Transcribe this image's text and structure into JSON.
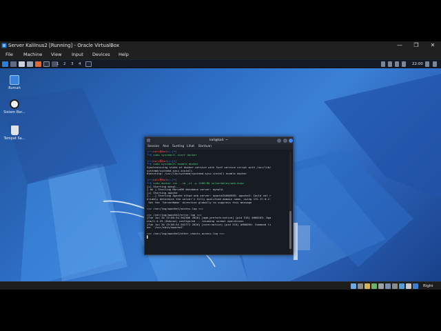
{
  "window": {
    "title": "Server KaliInus2 [Running] - Oracle VirtualBox",
    "controls": {
      "minimize": "—",
      "restore": "❐",
      "close": "✕"
    }
  },
  "menubar": {
    "items": [
      "File",
      "Machine",
      "View",
      "Input",
      "Devices",
      "Help"
    ]
  },
  "guest_panel": {
    "workspaces": [
      "1",
      "2",
      "3",
      "4"
    ],
    "clock": "22:00"
  },
  "desktop_icons": [
    {
      "label": "Rumah",
      "icon": "home-folder-icon"
    },
    {
      "label": "Sistem Ber...",
      "icon": "filesystem-icon"
    },
    {
      "label": "Tempat Sa...",
      "icon": "trash-icon"
    }
  ],
  "terminal": {
    "title": "kali@kali: ~",
    "menu": [
      "Session",
      "Aksi",
      "Sunting",
      "Lihat",
      "Bantuan"
    ],
    "lines": [
      [
        {
          "t": "┌──(",
          "c": "c-blue"
        },
        {
          "t": "kali㉿kali",
          "c": "c-red"
        },
        {
          "t": ")-[",
          "c": "c-blue"
        },
        {
          "t": "~",
          "c": "c-white"
        },
        {
          "t": "]",
          "c": "c-blue"
        }
      ],
      [
        {
          "t": "└─$ ",
          "c": "c-blue"
        },
        {
          "t": "sudo systemctl start docker",
          "c": "c-green"
        }
      ],
      [
        {
          "t": "",
          "c": ""
        }
      ],
      [
        {
          "t": "┌──(",
          "c": "c-blue"
        },
        {
          "t": "kali㉿kali",
          "c": "c-red"
        },
        {
          "t": ")-[",
          "c": "c-blue"
        },
        {
          "t": "~",
          "c": "c-white"
        },
        {
          "t": "]",
          "c": "c-blue"
        }
      ],
      [
        {
          "t": "└─$ ",
          "c": "c-blue"
        },
        {
          "t": "sudo systemctl enable docker",
          "c": "c-green"
        }
      ],
      [
        {
          "t": "Synchronizing state of docker.service with SysV service script with /usr/lib/",
          "c": ""
        }
      ],
      [
        {
          "t": "systemd/systemd-sysv-install.",
          "c": ""
        }
      ],
      [
        {
          "t": "Executing: /usr/lib/systemd/systemd-sysv-install enable docker",
          "c": ""
        }
      ],
      [
        {
          "t": "",
          "c": ""
        }
      ],
      [
        {
          "t": "┌──(",
          "c": "c-blue"
        },
        {
          "t": "kali㉿kali",
          "c": "c-red"
        },
        {
          "t": ")-[",
          "c": "c-blue"
        },
        {
          "t": "~",
          "c": "c-white"
        },
        {
          "t": "]",
          "c": "c-blue"
        }
      ],
      [
        {
          "t": "└─$ ",
          "c": "c-blue"
        },
        {
          "t": "sudo docker run --rm -it -p 1280:80 vulnerables/web-dvwa",
          "c": "c-green"
        }
      ],
      [
        {
          "t": "[+] Starting mysql...",
          "c": ""
        }
      ],
      [
        {
          "t": "[ ok ] Starting MariaDB database server: mysqld.",
          "c": ""
        }
      ],
      [
        {
          "t": "[+] Starting apache",
          "c": ""
        }
      ],
      [
        {
          "t": "[....] Starting Apache httpd web server: apache2AH00558: apache2: Could not r",
          "c": ""
        }
      ],
      [
        {
          "t": "eliably determine the server's fully qualified domain name, using 172.17.0.2.",
          "c": ""
        }
      ],
      [
        {
          "t": " Set the 'ServerName' directive globally to suppress this message",
          "c": ""
        }
      ],
      [
        {
          "t": ".",
          "c": ""
        }
      ],
      [
        {
          "t": "==> /var/log/apache2/access.log <==",
          "c": ""
        }
      ],
      [
        {
          "t": "",
          "c": ""
        }
      ],
      [
        {
          "t": "==> /var/log/apache2/error.log <==",
          "c": ""
        }
      ],
      [
        {
          "t": "[Tue Jun 20 15:00:34.942306 2026] [mpm_prefork:notice] [pid 316] AH00163: Apa",
          "c": ""
        }
      ],
      [
        {
          "t": "che/2.4.25 (Debian) configured -- resuming normal operations",
          "c": ""
        }
      ],
      [
        {
          "t": "[Tue Jun 20 15:00:34.942771 2026] [core:notice] [pid 316] AH00094: Command li",
          "c": ""
        }
      ],
      [
        {
          "t": "ne: '/usr/sbin/apache2'",
          "c": ""
        }
      ],
      [
        {
          "t": "",
          "c": ""
        }
      ],
      [
        {
          "t": "==> /var/log/apache2/other_vhosts_access.log <==",
          "c": ""
        }
      ],
      [
        {
          "t": "▋",
          "c": "c-white"
        }
      ]
    ]
  },
  "statusbar": {
    "host_key": "Right Ctrl"
  },
  "colors": {
    "accent": "#3f86ff",
    "prompt_user": "#ff5555",
    "command": "#4fd47a"
  }
}
